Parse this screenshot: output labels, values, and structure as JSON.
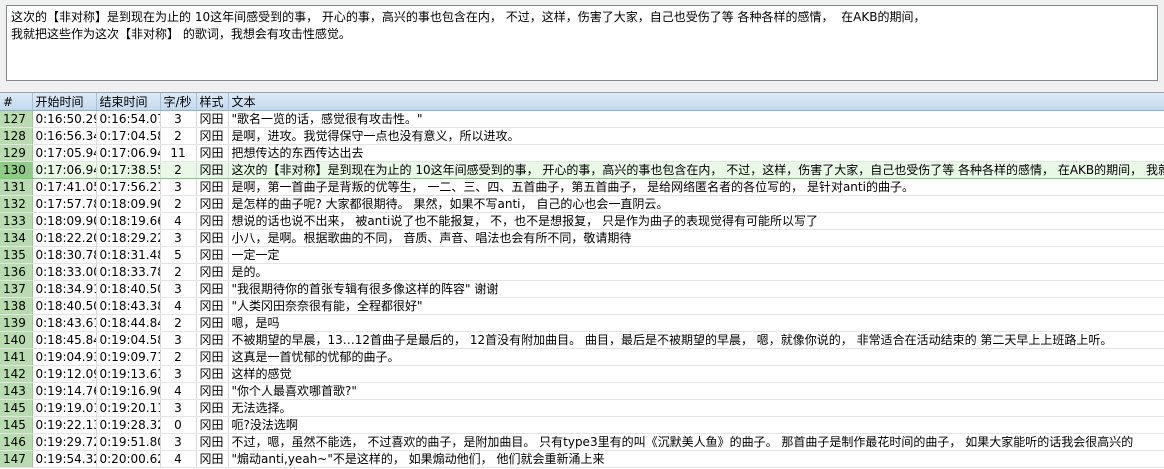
{
  "editor": {
    "text": "这次的【非对称】是到现在为止的 10这年间感受到的事， 开心的事，高兴的事也包含在内， 不过，这样，伤害了大家，自己也受伤了等 各种各样的感情，  在AKB的期间，\n我就把这些作为这次【非对称】 的歌词，我想会有攻击性感觉。"
  },
  "grid": {
    "columns": [
      "#",
      "开始时间",
      "结束时间",
      "字/秒",
      "样式",
      "文本"
    ],
    "selected_row": "130",
    "rows": [
      {
        "num": "127",
        "start": "0:16:50.29",
        "end": "0:16:54.07",
        "cps": "3",
        "style": "冈田",
        "text": "\"歌名一览的话，感觉很有攻击性。\""
      },
      {
        "num": "128",
        "start": "0:16:56.34",
        "end": "0:17:04.58",
        "cps": "2",
        "style": "冈田",
        "text": "是啊，进攻。我觉得保守一点也没有意义，所以进攻。"
      },
      {
        "num": "129",
        "start": "0:17:05.94",
        "end": "0:17:06.94",
        "cps": "11",
        "style": "冈田",
        "text": "把想传达的东西传达出去"
      },
      {
        "num": "130",
        "start": "0:17:06.94",
        "end": "0:17:38.55",
        "cps": "2",
        "style": "冈田",
        "text": "这次的【非对称】是到现在为止的 10这年间感受到的事， 开心的事，高兴的事也包含在内， 不过，这样，伤害了大家，自己也受伤了等 各种各样的感情，  在AKB的期间，  我就把这些作为这次【非对称】 的歌词，我想会有攻击性感觉。"
      },
      {
        "num": "131",
        "start": "0:17:41.05",
        "end": "0:17:56.21",
        "cps": "3",
        "style": "冈田",
        "text": "是啊，第一首曲子是背叛的优等生， 一二、三、四、五首曲子，第五首曲子， 是给网络匿名者的各位写的， 是针对anti的曲子。"
      },
      {
        "num": "132",
        "start": "0:17:57.78",
        "end": "0:18:09.90",
        "cps": "2",
        "style": "冈田",
        "text": "是怎样的曲子呢? 大家都很期待。 果然，如果不写anti， 自己的心也会一直阴云。"
      },
      {
        "num": "133",
        "start": "0:18:09.90",
        "end": "0:18:19.66",
        "cps": "4",
        "style": "冈田",
        "text": "想说的话也说不出来， 被anti说了也不能报复， 不，也不是想报复， 只是作为曲子的表现觉得有可能所以写了"
      },
      {
        "num": "134",
        "start": "0:18:22.20",
        "end": "0:18:29.22",
        "cps": "3",
        "style": "冈田",
        "text": "小八，是啊。根据歌曲的不同， 音质、声音、唱法也会有所不同，敬请期待"
      },
      {
        "num": "135",
        "start": "0:18:30.78",
        "end": "0:18:31.48",
        "cps": "5",
        "style": "冈田",
        "text": "一定一定"
      },
      {
        "num": "136",
        "start": "0:18:33.00",
        "end": "0:18:33.78",
        "cps": "2",
        "style": "冈田",
        "text": "是的。"
      },
      {
        "num": "137",
        "start": "0:18:34.91",
        "end": "0:18:40.50",
        "cps": "3",
        "style": "冈田",
        "text": "\"我很期待你的首张专辑有很多像这样的阵容\" 谢谢"
      },
      {
        "num": "138",
        "start": "0:18:40.50",
        "end": "0:18:43.38",
        "cps": "4",
        "style": "冈田",
        "text": "\"人类冈田奈奈很有能，全程都很好\""
      },
      {
        "num": "139",
        "start": "0:18:43.61",
        "end": "0:18:44.84",
        "cps": "2",
        "style": "冈田",
        "text": "嗯，是吗"
      },
      {
        "num": "140",
        "start": "0:18:45.84",
        "end": "0:19:04.58",
        "cps": "3",
        "style": "冈田",
        "text": "不被期望的早晨，13…12首曲子是最后的， 12首没有附加曲目。 曲目，最后是不被期望的早晨， 嗯，就像你说的， 非常适合在活动结束的 第二天早上上班路上听。"
      },
      {
        "num": "141",
        "start": "0:19:04.93",
        "end": "0:19:09.71",
        "cps": "2",
        "style": "冈田",
        "text": "这真是一首忧郁的忧郁的曲子。"
      },
      {
        "num": "142",
        "start": "0:19:12.09",
        "end": "0:19:13.61",
        "cps": "3",
        "style": "冈田",
        "text": "这样的感觉"
      },
      {
        "num": "143",
        "start": "0:19:14.76",
        "end": "0:19:16.90",
        "cps": "4",
        "style": "冈田",
        "text": "\"你个人最喜欢哪首歌?\""
      },
      {
        "num": "145",
        "start": "0:19:19.01",
        "end": "0:19:20.11",
        "cps": "3",
        "style": "冈田",
        "text": "无法选择。"
      },
      {
        "num": "145",
        "start": "0:19:22.13",
        "end": "0:19:28.32",
        "cps": "0",
        "style": "冈田",
        "text": "呃?没法选啊"
      },
      {
        "num": "146",
        "start": "0:19:29.72",
        "end": "0:19:51.80",
        "cps": "3",
        "style": "冈田",
        "text": "不过，嗯，虽然不能选， 不过喜欢的曲子，是附加曲目。 只有type3里有的叫《沉默美人鱼》的曲子。 那首曲子是制作最花时间的曲子， 如果大家能听的话我会很高兴的"
      },
      {
        "num": "147",
        "start": "0:19:54.32",
        "end": "0:20:00.62",
        "cps": "4",
        "style": "冈田",
        "text": "\"煽动anti,yeah~\"不是这样的， 如果煽动他们， 他们就会重新涌上来"
      }
    ]
  }
}
